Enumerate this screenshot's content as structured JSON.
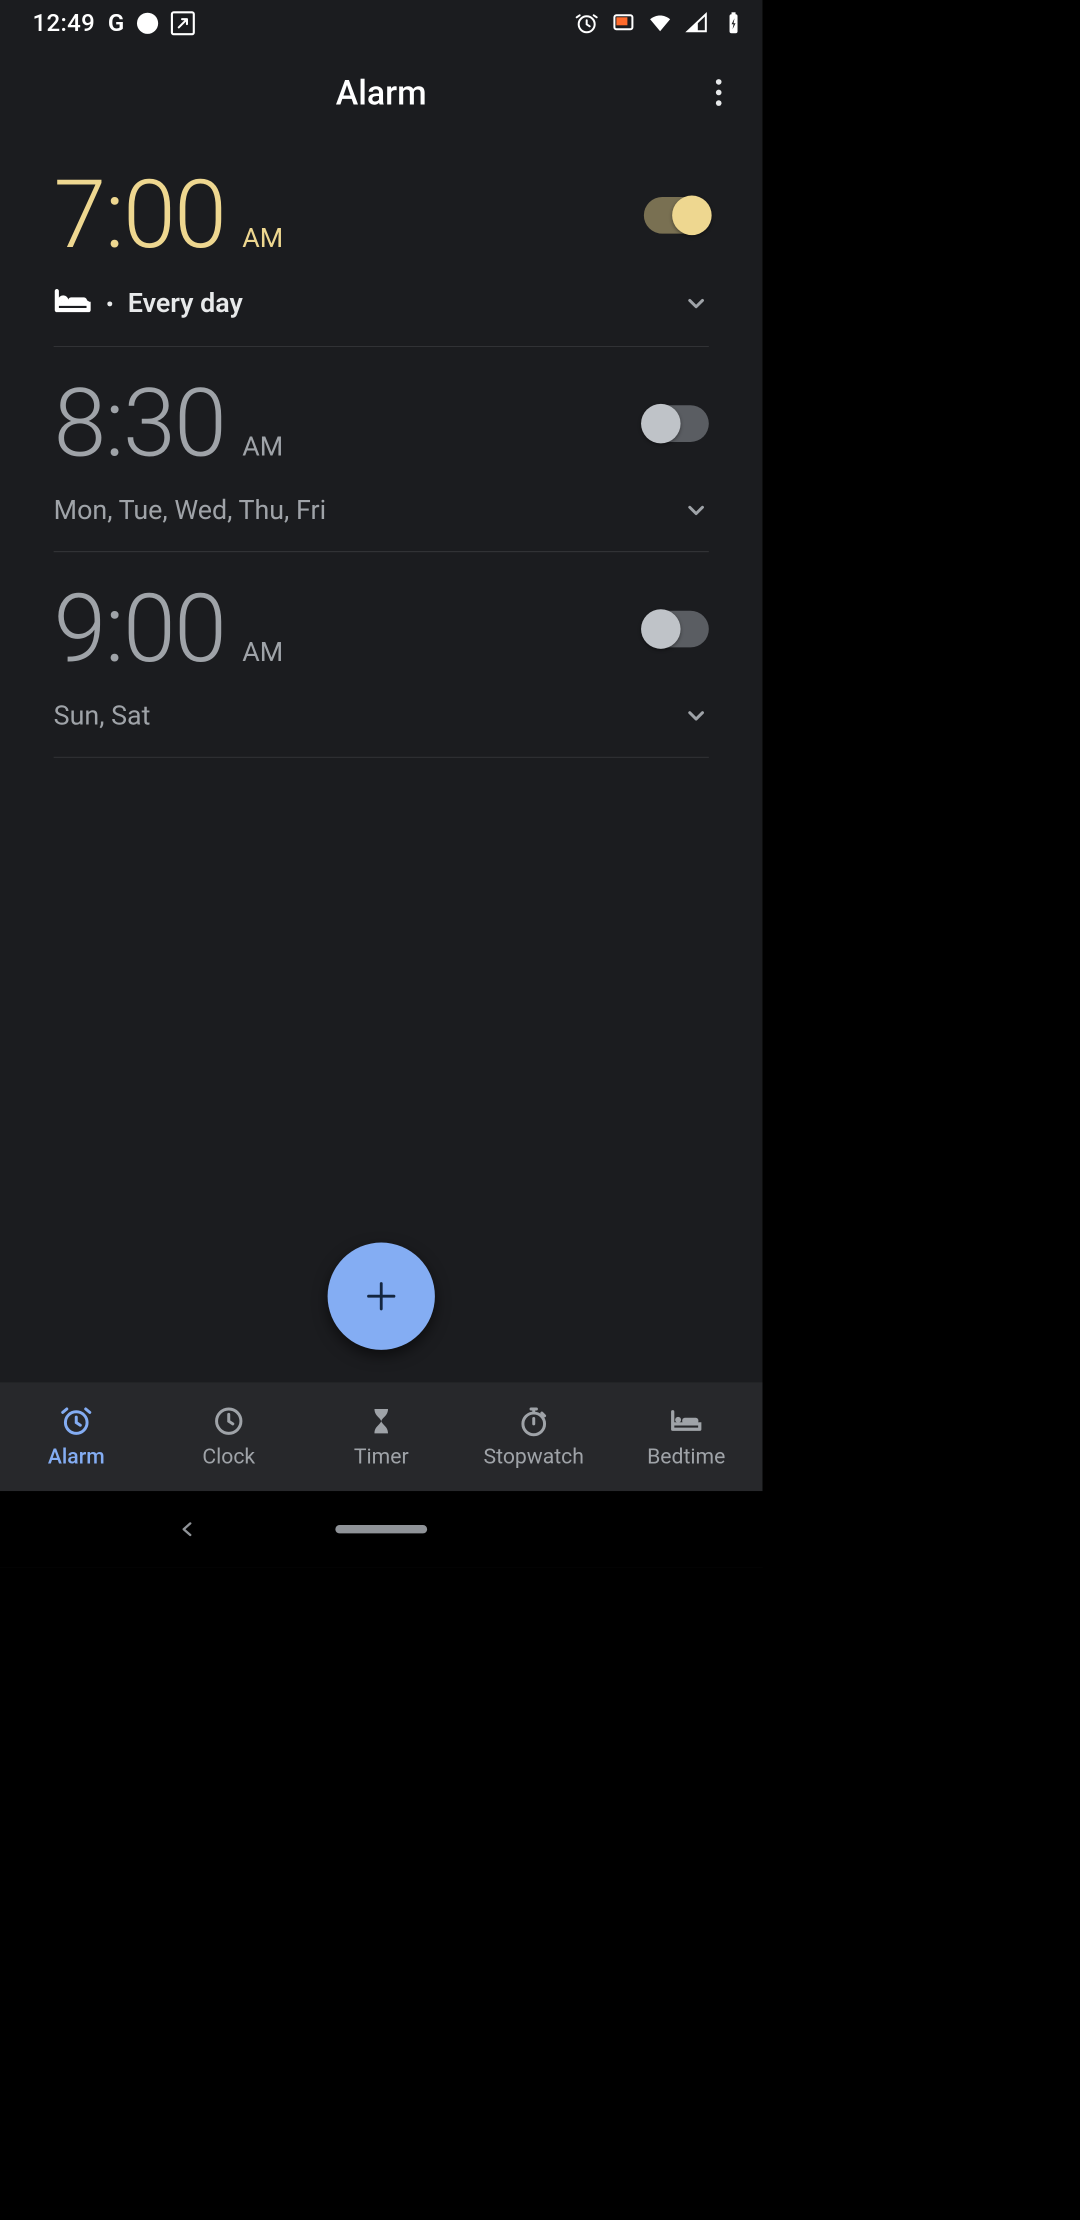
{
  "statusbar": {
    "time": "12:49"
  },
  "appbar": {
    "title": "Alarm"
  },
  "alarms": [
    {
      "time": "7:00",
      "ampm": "AM",
      "enabled": true,
      "has_bed_icon": true,
      "repeat_label": "Every day"
    },
    {
      "time": "8:30",
      "ampm": "AM",
      "enabled": false,
      "has_bed_icon": false,
      "repeat_label": "Mon, Tue, Wed, Thu, Fri"
    },
    {
      "time": "9:00",
      "ampm": "AM",
      "enabled": false,
      "has_bed_icon": false,
      "repeat_label": "Sun, Sat"
    }
  ],
  "bottom_nav": {
    "items": [
      {
        "label": "Alarm",
        "icon": "alarm-icon",
        "active": true
      },
      {
        "label": "Clock",
        "icon": "clock-icon",
        "active": false
      },
      {
        "label": "Timer",
        "icon": "timer-icon",
        "active": false
      },
      {
        "label": "Stopwatch",
        "icon": "stopwatch-icon",
        "active": false
      },
      {
        "label": "Bedtime",
        "icon": "bedtime-icon",
        "active": false
      }
    ]
  },
  "colors": {
    "accent_yellow": "#eed790",
    "accent_blue": "#84adf3",
    "background": "#1b1c1f",
    "nav_background": "#27282b",
    "inactive": "#9fa3a8"
  }
}
